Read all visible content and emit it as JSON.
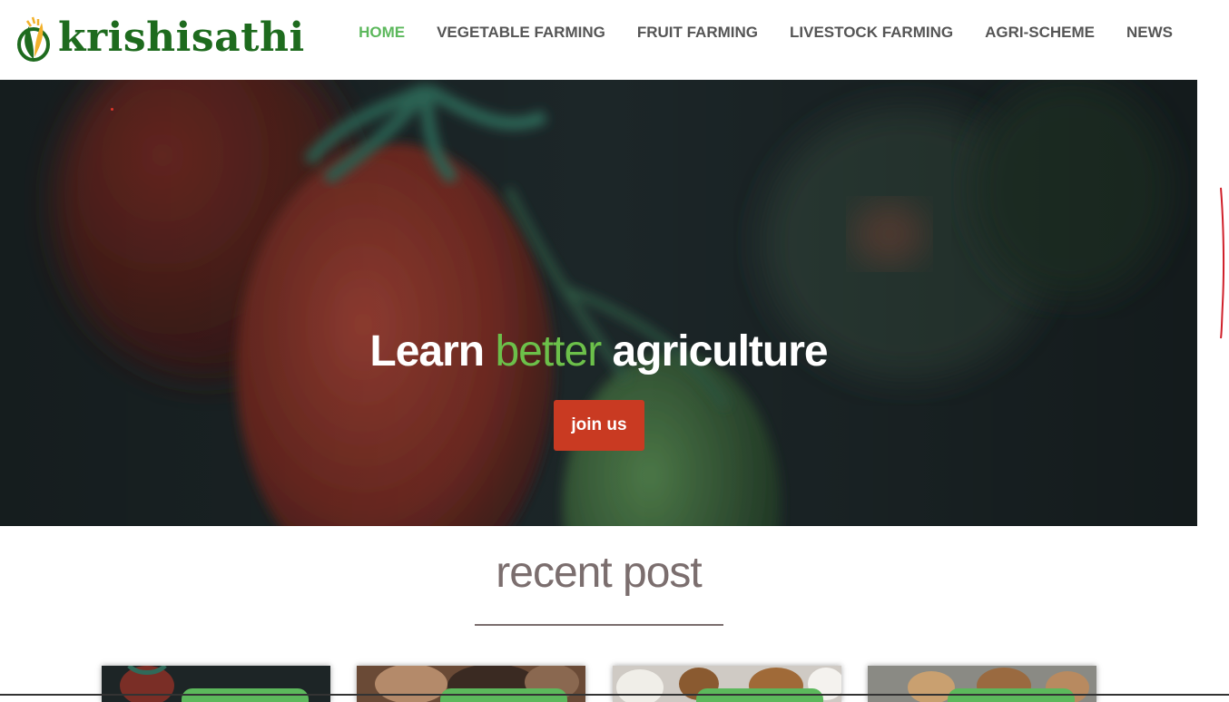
{
  "brand": {
    "name": "krishisathi",
    "color": "#1e6b1e"
  },
  "nav": {
    "items": [
      {
        "label": "HOME",
        "active": true
      },
      {
        "label": "VEGETABLE FARMING",
        "active": false
      },
      {
        "label": "FRUIT FARMING",
        "active": false
      },
      {
        "label": "LIVESTOCK FARMING",
        "active": false
      },
      {
        "label": "AGRI-SCHEME",
        "active": false
      },
      {
        "label": "NEWS",
        "active": false
      }
    ],
    "active_color": "#5cb85c"
  },
  "hero": {
    "title_before": "Learn",
    "title_accent": "better",
    "title_after": "agriculture",
    "accent_color": "#6cc04a",
    "button_label": "join us",
    "button_color": "#c93a22",
    "background": "tomato-photo"
  },
  "recent": {
    "title": "recent post",
    "cards": [
      {
        "image": "tomato-photo"
      },
      {
        "image": "cattle-photo"
      },
      {
        "image": "chickens-photo"
      },
      {
        "image": "mushrooms-photo"
      }
    ]
  }
}
